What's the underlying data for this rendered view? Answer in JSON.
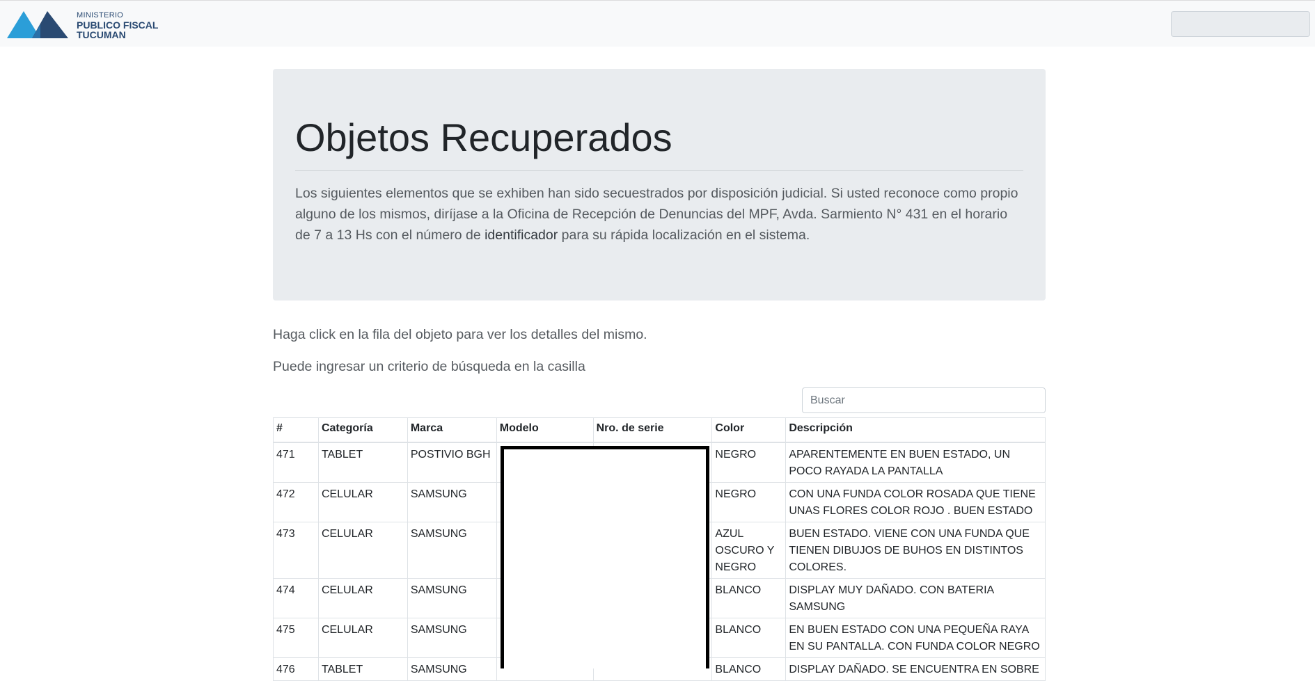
{
  "navbar": {
    "logo": {
      "line1": "MINISTERIO",
      "line2": "PUBLICO FISCAL",
      "line3": "TUCUMAN"
    },
    "colors": {
      "logo_left": "#2b9ed8",
      "logo_right": "#2a4a72"
    }
  },
  "jumbotron": {
    "title": "Objetos Recuperados",
    "text_before": "Los siguientes elementos que se exhiben han sido secuestrados por disposición judicial. Si usted reconoce como propio alguno de los mismos, diríjase a la Oficina de Recepción de Denuncias del MPF, Avda. Sarmiento N° 431 en el horario de 7 a 13 Hs con el número de ",
    "text_bold": "identificador",
    "text_after": " para su rápida localización en el sistema."
  },
  "instructions": {
    "line1": "Haga click en la fila del objeto para ver los detalles del mismo.",
    "line2": "Puede ingresar un criterio de búsqueda en la casilla"
  },
  "search": {
    "placeholder": "Buscar",
    "value": ""
  },
  "table": {
    "columns": [
      "#",
      "Categoría",
      "Marca",
      "Modelo",
      "Nro. de serie",
      "Color",
      "Descripción"
    ],
    "rows": [
      [
        "471",
        "TABLET",
        "POSTIVIO BGH",
        "",
        "",
        "NEGRO",
        "APARENTEMENTE EN BUEN ESTADO, UN POCO RAYADA LA PANTALLA"
      ],
      [
        "472",
        "CELULAR",
        "SAMSUNG",
        "",
        "",
        "NEGRO",
        "CON UNA FUNDA COLOR ROSADA QUE TIENE UNAS FLORES COLOR ROJO . BUEN ESTADO"
      ],
      [
        "473",
        "CELULAR",
        "SAMSUNG",
        "",
        "",
        "AZUL OSCURO Y NEGRO",
        "BUEN ESTADO. VIENE CON UNA FUNDA QUE TIENEN DIBUJOS DE BUHOS EN DISTINTOS COLORES."
      ],
      [
        "474",
        "CELULAR",
        "SAMSUNG",
        "",
        "",
        "BLANCO",
        "DISPLAY MUY DAÑADO. CON BATERIA SAMSUNG"
      ],
      [
        "475",
        "CELULAR",
        "SAMSUNG",
        "",
        "",
        "BLANCO",
        "EN BUEN ESTADO CON UNA PEQUEÑA RAYA EN SU PANTALLA. CON FUNDA COLOR NEGRO"
      ],
      [
        "476",
        "TABLET",
        "SAMSUNG",
        "",
        "",
        "BLANCO",
        "DISPLAY DAÑADO. SE ENCUENTRA EN SOBRE"
      ]
    ]
  }
}
